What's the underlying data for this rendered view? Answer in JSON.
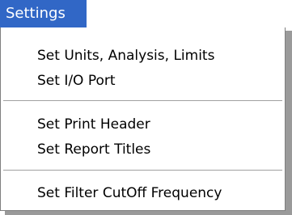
{
  "menu": {
    "title": "Settings",
    "items": [
      {
        "label": "Set Units, Analysis, Limits"
      },
      {
        "label": "Set I/O Port"
      },
      {
        "label": "Set Print Header"
      },
      {
        "label": "Set Report Titles"
      },
      {
        "label": "Set Filter CutOff Frequency"
      }
    ]
  },
  "colors": {
    "highlight": "#3167c6",
    "menu_background": "#ffffff",
    "separator": "#a0a0a0"
  }
}
